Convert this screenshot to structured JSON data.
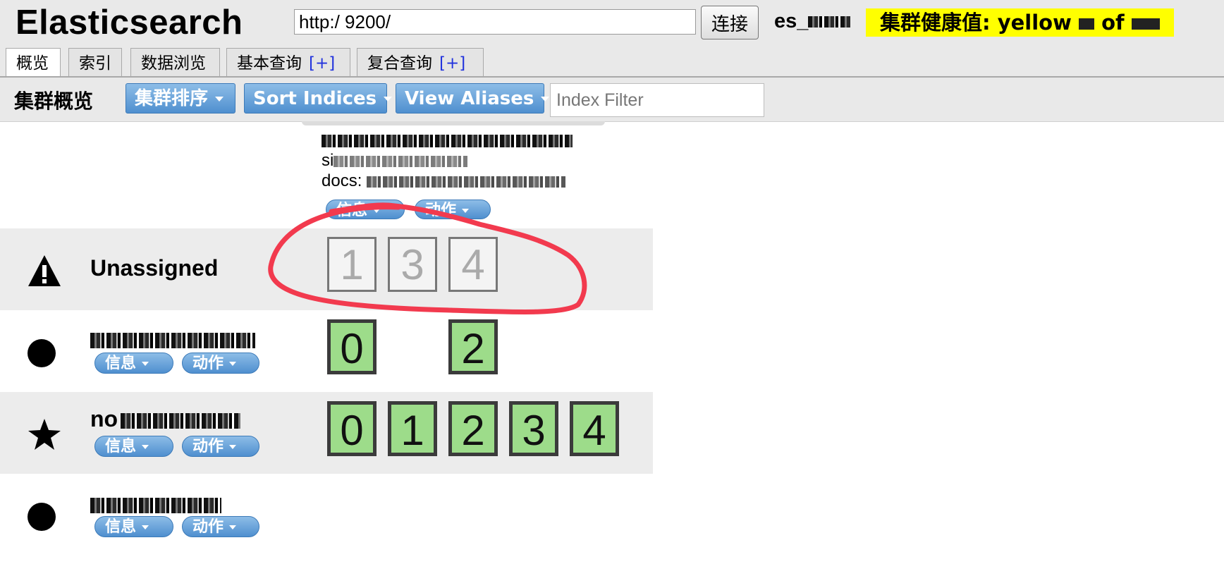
{
  "header": {
    "app_title": "Elasticsearch",
    "url_value": "http:/ 9200/",
    "connect_label": "连接",
    "cluster_name": "es_",
    "health_prefix": "集群健康值: yellow",
    "health_suffix": "of"
  },
  "tabs": [
    {
      "label": "概览",
      "active": true,
      "plus": ""
    },
    {
      "label": "索引",
      "active": false,
      "plus": ""
    },
    {
      "label": "数据浏览",
      "active": false,
      "plus": ""
    },
    {
      "label": "基本查询",
      "active": false,
      "plus": "[+]"
    },
    {
      "label": "复合查询",
      "active": false,
      "plus": "[+]"
    }
  ],
  "toolbar": {
    "title": "集群概览",
    "cluster_sort_label": "集群排序",
    "sort_indices_label": "Sort Indices",
    "view_aliases_label": "View Aliases",
    "index_filter_placeholder": "Index Filter"
  },
  "index_card": {
    "size_label": "si",
    "docs_label": "docs:",
    "info_label": "信息",
    "action_label": "动作"
  },
  "rows": {
    "unassigned": {
      "label": "Unassigned",
      "icon": "warning-icon",
      "shards": [
        "1",
        "3",
        "4"
      ]
    },
    "node1": {
      "icon": "circle-icon",
      "info_label": "信息",
      "action_label": "动作",
      "shards": [
        "0",
        "2"
      ]
    },
    "node2": {
      "name_prefix": "no",
      "icon": "star-icon",
      "info_label": "信息",
      "action_label": "动作",
      "shards": [
        "0",
        "1",
        "2",
        "3",
        "4"
      ]
    },
    "node3": {
      "icon": "circle-icon",
      "info_label": "信息",
      "action_label": "动作"
    }
  },
  "colors": {
    "health": "#ffff00",
    "started_shard": "#9ddc8a",
    "button_blue": "#4f8fcf",
    "annotation_red": "#f23a4e"
  }
}
